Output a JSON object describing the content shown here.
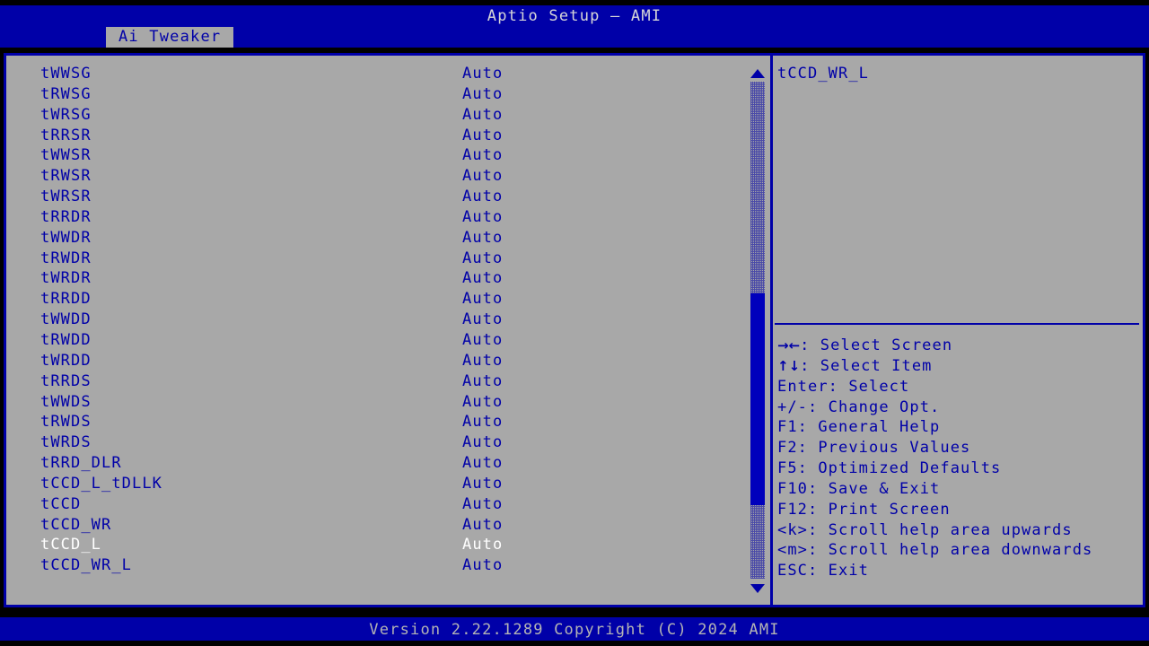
{
  "header": {
    "title": "Aptio Setup – AMI"
  },
  "tabs": [
    {
      "label": "Ai Tweaker",
      "active": true
    }
  ],
  "settings_list": {
    "selected_index": 23,
    "rows": [
      {
        "name": "tWWSG",
        "value": "Auto"
      },
      {
        "name": "tRWSG",
        "value": "Auto"
      },
      {
        "name": "tWRSG",
        "value": "Auto"
      },
      {
        "name": "tRRSR",
        "value": "Auto"
      },
      {
        "name": "tWWSR",
        "value": "Auto"
      },
      {
        "name": "tRWSR",
        "value": "Auto"
      },
      {
        "name": "tWRSR",
        "value": "Auto"
      },
      {
        "name": "tRRDR",
        "value": "Auto"
      },
      {
        "name": "tWWDR",
        "value": "Auto"
      },
      {
        "name": "tRWDR",
        "value": "Auto"
      },
      {
        "name": "tWRDR",
        "value": "Auto"
      },
      {
        "name": "tRRDD",
        "value": "Auto"
      },
      {
        "name": "tWWDD",
        "value": "Auto"
      },
      {
        "name": "tRWDD",
        "value": "Auto"
      },
      {
        "name": "tWRDD",
        "value": "Auto"
      },
      {
        "name": "tRRDS",
        "value": "Auto"
      },
      {
        "name": "tWWDS",
        "value": "Auto"
      },
      {
        "name": "tRWDS",
        "value": "Auto"
      },
      {
        "name": "tWRDS",
        "value": "Auto"
      },
      {
        "name": "tRRD_DLR",
        "value": "Auto"
      },
      {
        "name": "tCCD_L_tDLLK",
        "value": "Auto"
      },
      {
        "name": "tCCD",
        "value": "Auto"
      },
      {
        "name": "tCCD_WR",
        "value": "Auto"
      },
      {
        "name": "tCCD_L",
        "value": "Auto"
      },
      {
        "name": "tCCD_WR_L",
        "value": "Auto"
      }
    ]
  },
  "scrollbar": {
    "up_arrow": "scroll-up-arrow",
    "down_arrow": "scroll-down-arrow"
  },
  "help_panel": {
    "title": "tCCD_WR_L",
    "keys": [
      {
        "glyph": "→←",
        "text": ": Select Screen"
      },
      {
        "glyph": "↑↓",
        "text": ": Select Item"
      },
      {
        "glyph": "",
        "text": "Enter: Select"
      },
      {
        "glyph": "",
        "text": "+/-: Change Opt."
      },
      {
        "glyph": "",
        "text": "F1: General Help"
      },
      {
        "glyph": "",
        "text": "F2: Previous Values"
      },
      {
        "glyph": "",
        "text": "F5: Optimized Defaults"
      },
      {
        "glyph": "",
        "text": "F10: Save & Exit"
      },
      {
        "glyph": "",
        "text": "F12: Print Screen"
      },
      {
        "glyph": "",
        "text": "<k>: Scroll help area upwards"
      },
      {
        "glyph": "",
        "text": "<m>: Scroll help area downwards"
      },
      {
        "glyph": "",
        "text": "ESC: Exit"
      }
    ]
  },
  "footer": {
    "text": "Version 2.22.1289 Copyright (C) 2024 AMI"
  },
  "colors": {
    "background": "#000000",
    "panel": "#a8a8a8",
    "accent_blue": "#0000a8",
    "text_blue": "#0000a8",
    "text_light": "#d8d8d8",
    "selected_text": "#ffffff"
  }
}
